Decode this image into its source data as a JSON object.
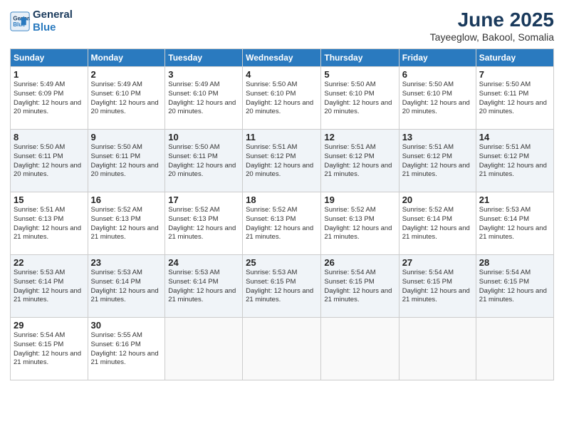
{
  "logo": {
    "line1": "General",
    "line2": "Blue"
  },
  "title": "June 2025",
  "subtitle": "Tayeeglow, Bakool, Somalia",
  "header_days": [
    "Sunday",
    "Monday",
    "Tuesday",
    "Wednesday",
    "Thursday",
    "Friday",
    "Saturday"
  ],
  "weeks": [
    [
      {
        "day": "1",
        "sunrise": "5:49 AM",
        "sunset": "6:09 PM",
        "daylight": "12 hours and 20 minutes."
      },
      {
        "day": "2",
        "sunrise": "5:49 AM",
        "sunset": "6:10 PM",
        "daylight": "12 hours and 20 minutes."
      },
      {
        "day": "3",
        "sunrise": "5:49 AM",
        "sunset": "6:10 PM",
        "daylight": "12 hours and 20 minutes."
      },
      {
        "day": "4",
        "sunrise": "5:50 AM",
        "sunset": "6:10 PM",
        "daylight": "12 hours and 20 minutes."
      },
      {
        "day": "5",
        "sunrise": "5:50 AM",
        "sunset": "6:10 PM",
        "daylight": "12 hours and 20 minutes."
      },
      {
        "day": "6",
        "sunrise": "5:50 AM",
        "sunset": "6:10 PM",
        "daylight": "12 hours and 20 minutes."
      },
      {
        "day": "7",
        "sunrise": "5:50 AM",
        "sunset": "6:11 PM",
        "daylight": "12 hours and 20 minutes."
      }
    ],
    [
      {
        "day": "8",
        "sunrise": "5:50 AM",
        "sunset": "6:11 PM",
        "daylight": "12 hours and 20 minutes."
      },
      {
        "day": "9",
        "sunrise": "5:50 AM",
        "sunset": "6:11 PM",
        "daylight": "12 hours and 20 minutes."
      },
      {
        "day": "10",
        "sunrise": "5:50 AM",
        "sunset": "6:11 PM",
        "daylight": "12 hours and 20 minutes."
      },
      {
        "day": "11",
        "sunrise": "5:51 AM",
        "sunset": "6:12 PM",
        "daylight": "12 hours and 20 minutes."
      },
      {
        "day": "12",
        "sunrise": "5:51 AM",
        "sunset": "6:12 PM",
        "daylight": "12 hours and 21 minutes."
      },
      {
        "day": "13",
        "sunrise": "5:51 AM",
        "sunset": "6:12 PM",
        "daylight": "12 hours and 21 minutes."
      },
      {
        "day": "14",
        "sunrise": "5:51 AM",
        "sunset": "6:12 PM",
        "daylight": "12 hours and 21 minutes."
      }
    ],
    [
      {
        "day": "15",
        "sunrise": "5:51 AM",
        "sunset": "6:13 PM",
        "daylight": "12 hours and 21 minutes."
      },
      {
        "day": "16",
        "sunrise": "5:52 AM",
        "sunset": "6:13 PM",
        "daylight": "12 hours and 21 minutes."
      },
      {
        "day": "17",
        "sunrise": "5:52 AM",
        "sunset": "6:13 PM",
        "daylight": "12 hours and 21 minutes."
      },
      {
        "day": "18",
        "sunrise": "5:52 AM",
        "sunset": "6:13 PM",
        "daylight": "12 hours and 21 minutes."
      },
      {
        "day": "19",
        "sunrise": "5:52 AM",
        "sunset": "6:13 PM",
        "daylight": "12 hours and 21 minutes."
      },
      {
        "day": "20",
        "sunrise": "5:52 AM",
        "sunset": "6:14 PM",
        "daylight": "12 hours and 21 minutes."
      },
      {
        "day": "21",
        "sunrise": "5:53 AM",
        "sunset": "6:14 PM",
        "daylight": "12 hours and 21 minutes."
      }
    ],
    [
      {
        "day": "22",
        "sunrise": "5:53 AM",
        "sunset": "6:14 PM",
        "daylight": "12 hours and 21 minutes."
      },
      {
        "day": "23",
        "sunrise": "5:53 AM",
        "sunset": "6:14 PM",
        "daylight": "12 hours and 21 minutes."
      },
      {
        "day": "24",
        "sunrise": "5:53 AM",
        "sunset": "6:14 PM",
        "daylight": "12 hours and 21 minutes."
      },
      {
        "day": "25",
        "sunrise": "5:53 AM",
        "sunset": "6:15 PM",
        "daylight": "12 hours and 21 minutes."
      },
      {
        "day": "26",
        "sunrise": "5:54 AM",
        "sunset": "6:15 PM",
        "daylight": "12 hours and 21 minutes."
      },
      {
        "day": "27",
        "sunrise": "5:54 AM",
        "sunset": "6:15 PM",
        "daylight": "12 hours and 21 minutes."
      },
      {
        "day": "28",
        "sunrise": "5:54 AM",
        "sunset": "6:15 PM",
        "daylight": "12 hours and 21 minutes."
      }
    ],
    [
      {
        "day": "29",
        "sunrise": "5:54 AM",
        "sunset": "6:15 PM",
        "daylight": "12 hours and 21 minutes."
      },
      {
        "day": "30",
        "sunrise": "5:55 AM",
        "sunset": "6:16 PM",
        "daylight": "12 hours and 21 minutes."
      },
      null,
      null,
      null,
      null,
      null
    ]
  ],
  "labels": {
    "sunrise": "Sunrise: ",
    "sunset": "Sunset: ",
    "daylight": "Daylight: "
  }
}
